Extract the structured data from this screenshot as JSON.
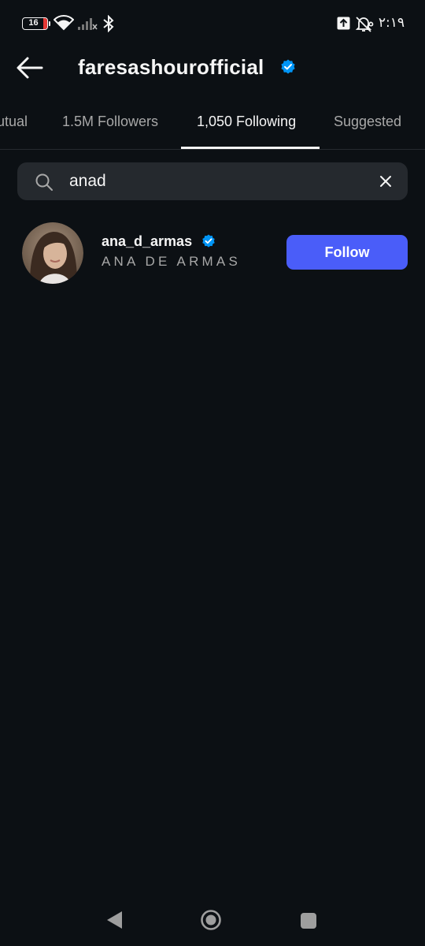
{
  "status_bar": {
    "battery_level": "16",
    "time": "٢:١٩ م"
  },
  "header": {
    "title": "faresashourofficial"
  },
  "tabs": [
    {
      "label": "utual"
    },
    {
      "label": "1.5M Followers"
    },
    {
      "label": "1,050 Following",
      "active": true
    },
    {
      "label": "Suggested"
    }
  ],
  "search": {
    "value": "anad"
  },
  "results": [
    {
      "username": "ana_d_armas",
      "full_name": "ANA DE ARMAS",
      "verified": true,
      "follow_label": "Follow"
    }
  ],
  "colors": {
    "background": "#0c1014",
    "follow_button": "#4a5df9",
    "verified_badge": "#0095f6",
    "secondary_text": "#a8a8a8"
  },
  "icons": {
    "back": "arrow-left-icon",
    "verified": "verified-badge-icon",
    "search": "search-icon",
    "clear": "close-icon"
  }
}
